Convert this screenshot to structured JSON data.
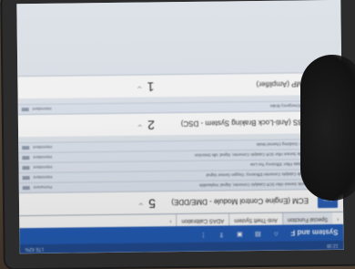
{
  "statusbar": {
    "time": "12:38",
    "signal": "LTE 62%"
  },
  "appbar": {
    "title": "System and F"
  },
  "tabs": [
    {
      "label": "Special Function"
    },
    {
      "label": "Anti-Theft System"
    },
    {
      "label": "ADAS Calibration"
    }
  ],
  "ecus": [
    {
      "name": "ECM (Engine Control Module - DME/DDE)",
      "count": "5",
      "button": "Enter",
      "dtcs": [
        {
          "code": "2D6000 Nitrogen Oxide Sensor After SCR Catalytic Converter, Signal: Implausible",
          "status": "Permanent"
        },
        {
          "code": "2D6A00 Nitrogen Oxide Catalytic Converter Efficiency: Oxygen Sensor Signal",
          "status": "Intermittent"
        },
        {
          "code": "2A9100 Diesel Particulate Filter: Efficiency Too Low",
          "status": "Intermittent"
        },
        {
          "code": "2D5F00 Nitrogen Oxide Sensor After SCR Catalytic Converter, Signal: Idle Detection",
          "status": "Intermittent"
        },
        {
          "code": "Fuel High Pr. Cylinder: Oxidizing Channel Mode",
          "status": "Intermittent"
        }
      ]
    },
    {
      "name": "ABS (Anti-Lock Braking System - DSC)",
      "count": "2",
      "button": "Enter",
      "dtcs": [
        {
          "code": "Air Pressure Sensor: Emergency Brake",
          "status": "Intermittent"
        }
      ]
    },
    {
      "name": "AMP (Amplifier)",
      "count": "1",
      "button": "Enter",
      "dtcs": []
    }
  ]
}
